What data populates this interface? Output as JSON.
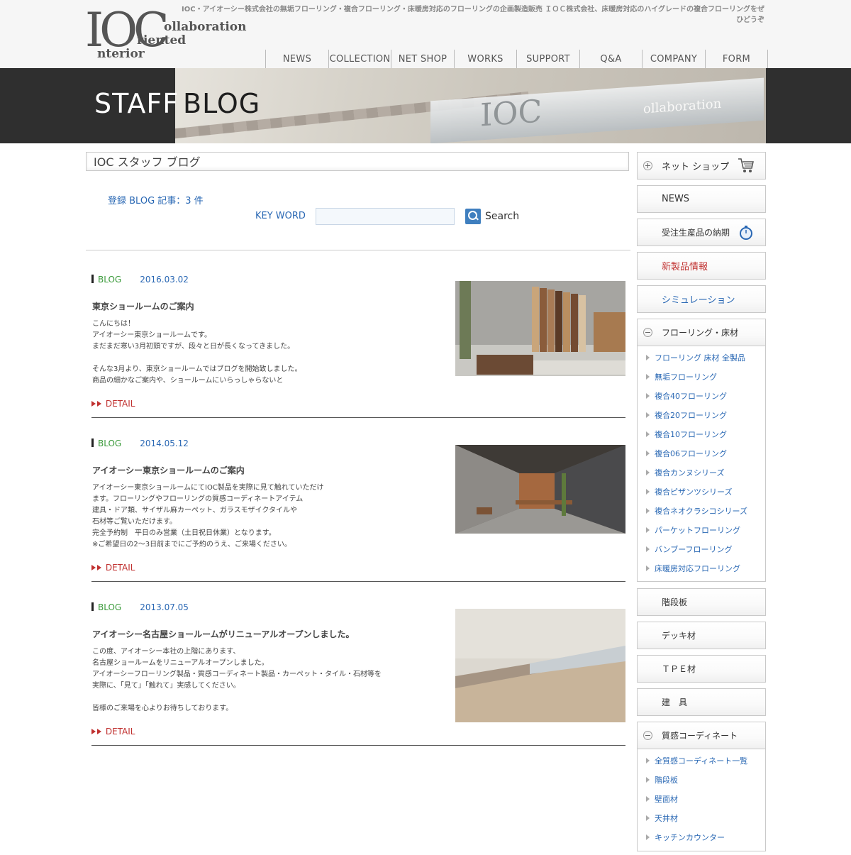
{
  "header": {
    "logo": {
      "big": "IOC",
      "line1": "ollaboration",
      "line2": "riented",
      "line3": "nterior"
    },
    "tagline_line1": "IOC・アイオーシー株式会社の無垢フローリング・複合フローリング・床暖房対応のフローリングの企画製造販売 ＩＯＣ株式会社、床暖房対応のハイグレードの複合フローリングをぜ",
    "tagline_line2": "ひどうぞ"
  },
  "nav": [
    "NEWS",
    "COLLECTION",
    "NET SHOP",
    "WORKS",
    "SUPPORT",
    "Q&A",
    "COMPANY",
    "FORM"
  ],
  "banner": {
    "title_part1": "STAFF",
    "title_part2": "BLOG",
    "photo_text1": "IOC",
    "photo_text2": "ollaboration"
  },
  "main": {
    "heading": "IOC スタッフ ブログ",
    "count_label": "登録 BLOG 記事：3 件",
    "keyword_label": "KEY WORD",
    "keyword_value": "",
    "search_label": "Search",
    "detail_label": "DETAIL",
    "posts": [
      {
        "category": "BLOG",
        "date": "2016.03.02",
        "title": "東京ショールームのご案内",
        "body": "こんにちは！\nアイオーシー東京ショールームです。\nまだまだ寒い3月初頭ですが、段々と日が長くなってきました。\n\nそんな3月より、東京ショールームではブログを開始致しました。\n商品の細かなご案内や、ショールームにいらっしゃらないと"
      },
      {
        "category": "BLOG",
        "date": "2014.05.12",
        "title": "アイオーシー東京ショールームのご案内",
        "body": "アイオーシー東京ショールームにてIOC製品を実際に見て触れていただけ\nます。フローリングやフローリングの質感コーディネートアイテム\n建具・ドア類、サイザル麻カーペット、ガラスモザイクタイルや\n石材等ご覧いただけます。\n完全予約制　平日のみ営業（土日祝日休業）となります。\n※ご希望日の2～3日前までにご予約のうえ、ご来場ください。"
      },
      {
        "category": "BLOG",
        "date": "2013.07.05",
        "title": "アイオーシー名古屋ショールームがリニューアルオープンしました。",
        "body": "この度、アイオーシー本社の上階にあります、\n名古屋ショールームをリニューアルオープンしました。\nアイオーシーフローリング製品・質感コーディネート製品・カーペット・タイル・石材等を\n実際に、「見て」「触れて」実感してください。\n\n皆様のご来場を心よりお待ちしております。"
      }
    ]
  },
  "sidebar": {
    "netshop": "ネット ショップ",
    "news": "NEWS",
    "delivery": "受注生産品の納期",
    "new_products": "新製品情報",
    "simulation": "シミュレーション",
    "flooring": "フローリング・床材",
    "flooring_items": [
      "フローリング 床材 全製品",
      "無垢フローリング",
      "複合40フローリング",
      "複合20フローリング",
      "複合10フローリング",
      "複合06フローリング",
      "複合カンヌシリーズ",
      "複合ピザンツシリーズ",
      "複合ネオクラシコシリーズ",
      "パーケットフローリング",
      "バンブーフローリング",
      "床暖房対応フローリング"
    ],
    "stairs": "階段板",
    "deck": "デッキ材",
    "tpe": "ＴＰＥ材",
    "fittings": "建　具",
    "coordinate": "質感コーディネート",
    "coordinate_items": [
      "全質感コーディネート一覧",
      "階段板",
      "壁面材",
      "天井材",
      "キッチンカウンター"
    ]
  },
  "colors": {
    "link_blue": "#2a68b4",
    "category_green": "#3a9a3a",
    "detail_red": "#c0302f",
    "new_products_red": "#c0302f",
    "banner_dark": "#2f2f2f"
  }
}
